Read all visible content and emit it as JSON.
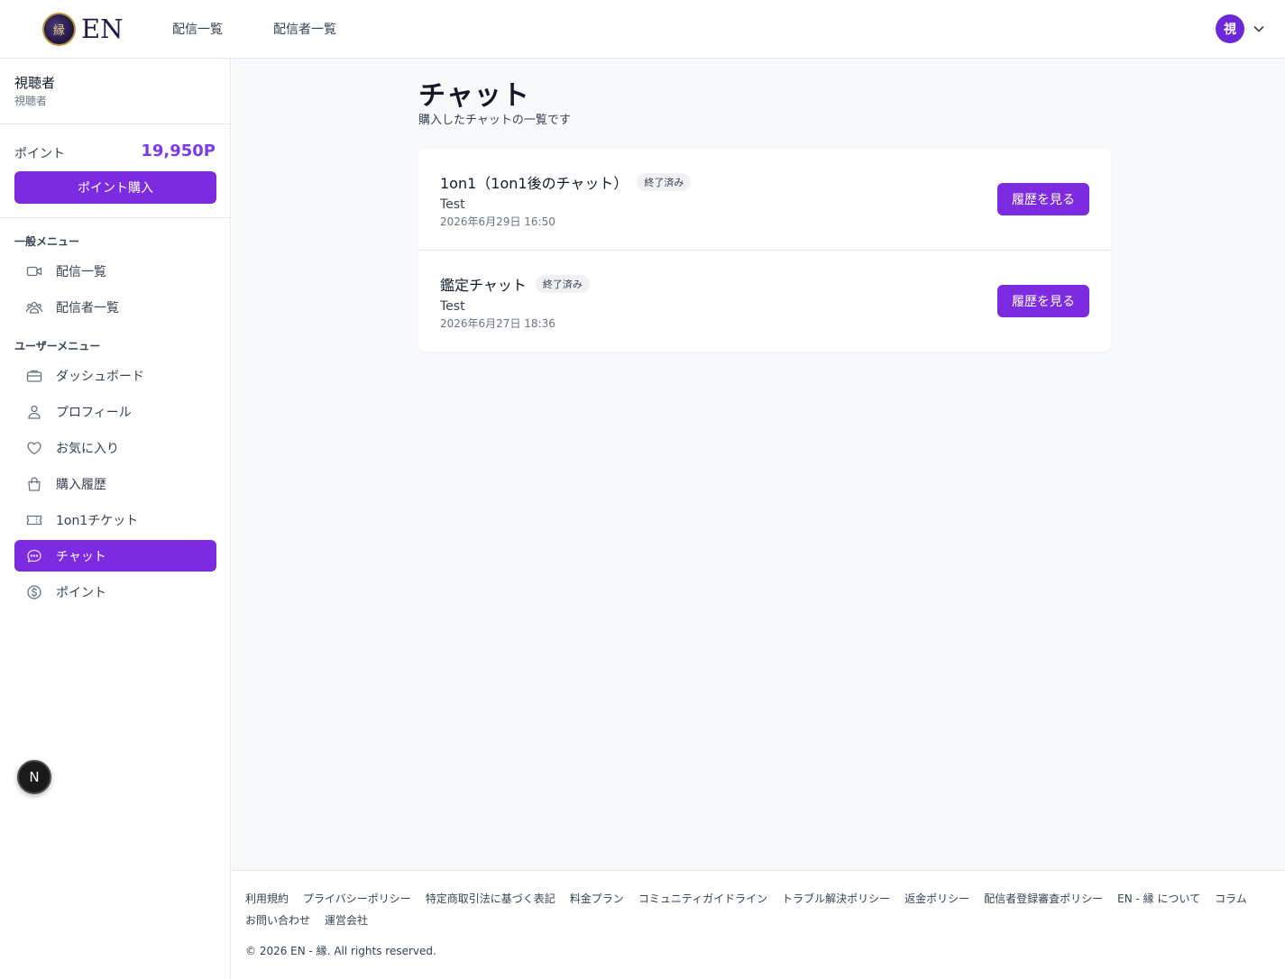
{
  "header": {
    "logo_emblem": "縁",
    "logo_text": "EN",
    "nav": [
      {
        "label": "配信一覧"
      },
      {
        "label": "配信者一覧"
      }
    ],
    "avatar_initial": "視"
  },
  "sidebar": {
    "user_name": "視聴者",
    "user_role": "視聴者",
    "points_label": "ポイント",
    "points_value": "19,950P",
    "buy_points_label": "ポイント購入",
    "general_menu_title": "一般メニュー",
    "general_menu": [
      {
        "label": "配信一覧",
        "icon": "video-camera-icon"
      },
      {
        "label": "配信者一覧",
        "icon": "users-icon"
      }
    ],
    "user_menu_title": "ユーザーメニュー",
    "user_menu": [
      {
        "label": "ダッシュボード",
        "icon": "briefcase-icon"
      },
      {
        "label": "プロフィール",
        "icon": "user-icon"
      },
      {
        "label": "お気に入り",
        "icon": "heart-icon"
      },
      {
        "label": "購入履歴",
        "icon": "shopping-bag-icon"
      },
      {
        "label": "1on1チケット",
        "icon": "ticket-icon"
      },
      {
        "label": "チャット",
        "icon": "chat-bubble-icon",
        "active": true
      },
      {
        "label": "ポイント",
        "icon": "dollar-circle-icon"
      }
    ]
  },
  "dev_badge": "N",
  "main": {
    "title": "チャット",
    "subtitle": "購入したチャットの一覧です",
    "chats": [
      {
        "title": "1on1（1on1後のチャット）",
        "status": "終了済み",
        "name": "Test",
        "date": "2026年6月29日 16:50",
        "action_label": "履歴を見る"
      },
      {
        "title": "鑑定チャット",
        "status": "終了済み",
        "name": "Test",
        "date": "2026年6月27日 18:36",
        "action_label": "履歴を見る"
      }
    ]
  },
  "footer": {
    "links": [
      "利用規約",
      "プライバシーポリシー",
      "特定商取引法に基づく表記",
      "料金プラン",
      "コミュニティガイドライン",
      "トラブル解決ポリシー",
      "返金ポリシー",
      "配信者登録審査ポリシー",
      "EN - 縁 について",
      "コラム",
      "お問い合わせ",
      "運営会社"
    ],
    "copyright": "© 2026 EN - 縁. All rights reserved."
  },
  "colors": {
    "accent": "#7c2be0",
    "points": "#7c3aed",
    "avatar": "#6d28d9"
  }
}
